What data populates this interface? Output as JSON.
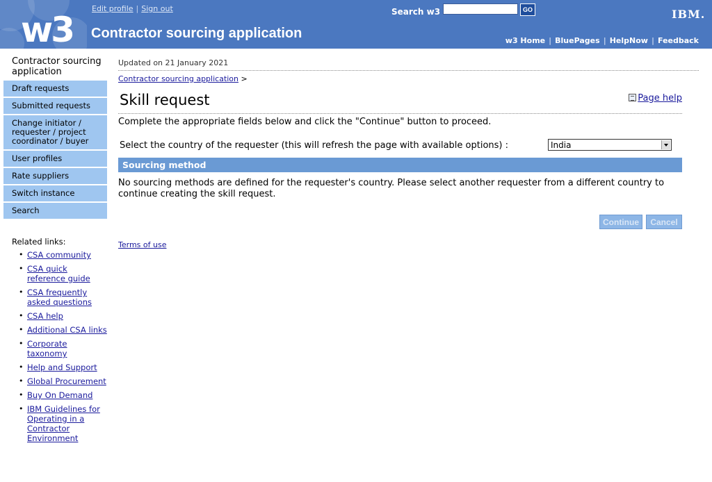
{
  "masthead": {
    "logo_text": "w3",
    "title": "Contractor sourcing application",
    "edit_profile": "Edit profile",
    "separator": "|",
    "sign_out": "Sign out",
    "search_label": "Search w3",
    "search_value": "",
    "go_label": "GO",
    "ibm_logo": "IBM.",
    "top_links": [
      "w3 Home",
      "BluePages",
      "HelpNow",
      "Feedback"
    ]
  },
  "sidebar": {
    "title": "Contractor sourcing application",
    "items": [
      {
        "label": "Draft requests"
      },
      {
        "label": "Submitted requests"
      },
      {
        "label": "Change initiator / requester / project coordinator / buyer"
      },
      {
        "label": "User profiles"
      },
      {
        "label": "Rate suppliers"
      },
      {
        "label": "Switch instance"
      },
      {
        "label": "Search"
      }
    ],
    "related_title": "Related links:",
    "related_links": [
      {
        "label": "CSA community"
      },
      {
        "label": "CSA quick reference guide"
      },
      {
        "label": "CSA frequently asked questions"
      },
      {
        "label": "CSA help"
      },
      {
        "label": "Additional CSA links"
      },
      {
        "label": "Corporate taxonomy"
      },
      {
        "label": "Help and Support"
      },
      {
        "label": "Global Procurement"
      },
      {
        "label": "Buy On Demand"
      },
      {
        "label": "IBM Guidelines for Operating in a Contractor Environment"
      }
    ]
  },
  "main": {
    "updated": "Updated on 21 January 2021",
    "breadcrumb_link": "Contractor sourcing application",
    "breadcrumb_sep": ">",
    "page_title": "Skill request",
    "page_help": "Page help",
    "instructions": "Complete the appropriate fields below and click the \"Continue\" button to proceed.",
    "country_label": "Select the country of the requester (this will refresh the page with available options) :",
    "country_value": "India",
    "section_title": "Sourcing method",
    "sourcing_message": "No sourcing methods are defined for the requester's country. Please select another requester from a different country to continue creating the skill request.",
    "continue_label": "Continue",
    "cancel_label": "Cancel",
    "terms_label": "Terms of use"
  },
  "colors": {
    "masthead": "#4b78c0",
    "nav_item": "#9fc6f0",
    "section_bar": "#6a9ad4",
    "link": "#1a1a9c"
  }
}
